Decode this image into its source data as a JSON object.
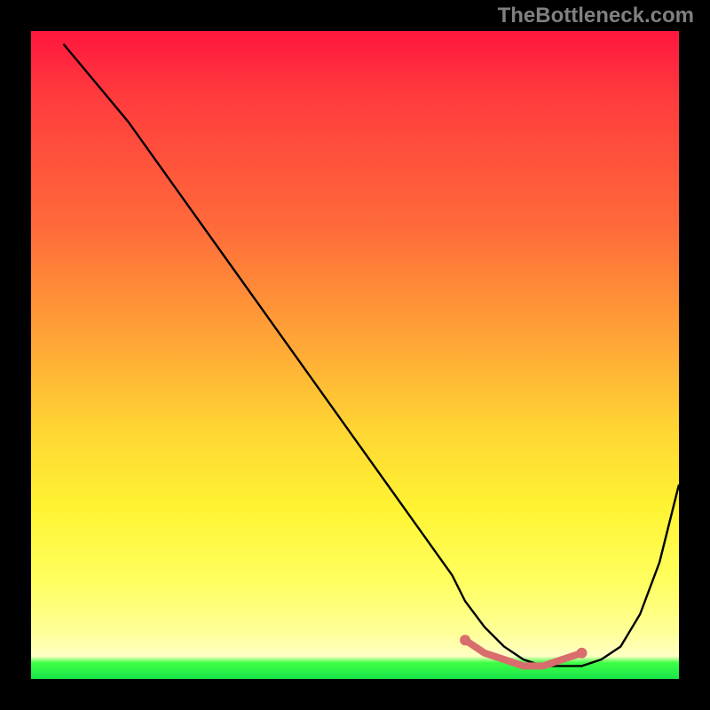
{
  "watermark": "TheBottleneck.com",
  "chart_data": {
    "type": "line",
    "title": "",
    "xlabel": "",
    "ylabel": "",
    "xlim": [
      0,
      100
    ],
    "ylim": [
      0,
      100
    ],
    "grid": false,
    "series": [
      {
        "name": "main-curve",
        "color": "#000000",
        "x": [
          5,
          10,
          15,
          20,
          25,
          30,
          35,
          40,
          45,
          50,
          55,
          60,
          65,
          67,
          70,
          73,
          76,
          79,
          82,
          85,
          88,
          91,
          94,
          97,
          100
        ],
        "values": [
          98,
          92,
          86,
          79,
          72,
          65,
          58,
          51,
          44,
          37,
          30,
          23,
          16,
          12,
          8,
          5,
          3,
          2,
          2,
          2,
          3,
          5,
          10,
          18,
          30
        ]
      },
      {
        "name": "highlight-band",
        "color": "#d96d6d",
        "x": [
          67,
          70,
          73,
          76,
          79,
          82,
          85
        ],
        "values": [
          6,
          4,
          3,
          2,
          2,
          3,
          4
        ]
      }
    ],
    "highlight_range_x": [
      67,
      85
    ]
  }
}
